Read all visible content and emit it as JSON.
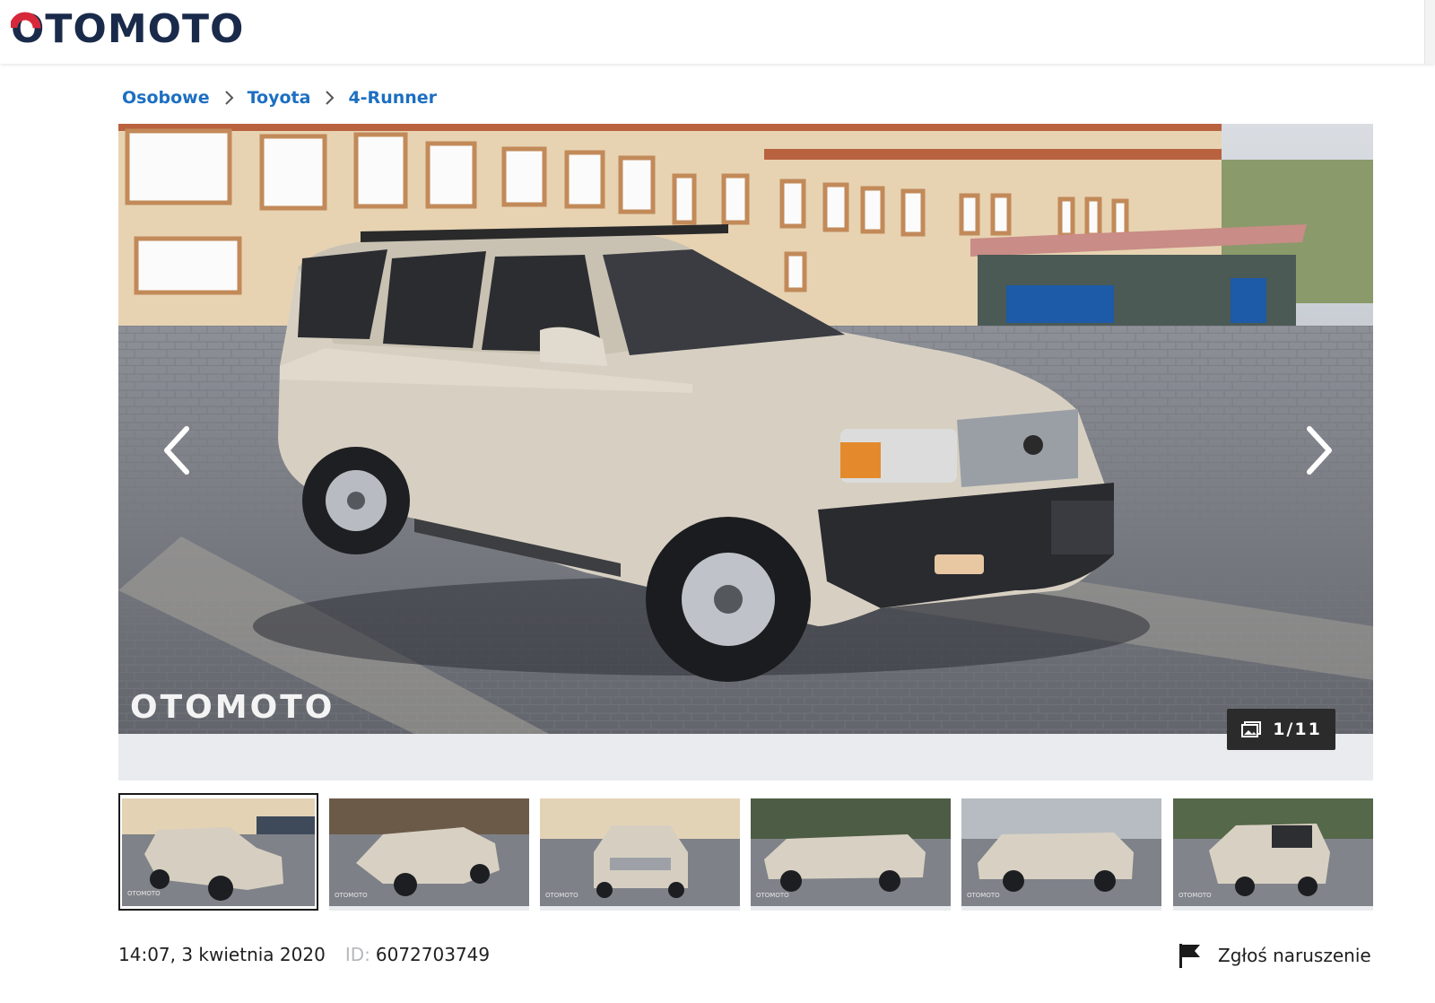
{
  "header": {
    "logo_text": "OTOMOTO"
  },
  "breadcrumb": {
    "items": [
      "Osobowe",
      "Toyota",
      "4-Runner"
    ]
  },
  "gallery": {
    "watermark": "OTOMOTO",
    "counter": "1/11",
    "prev_icon": "chevron-left-icon",
    "next_icon": "chevron-right-icon",
    "counter_icon": "photos-icon"
  },
  "thumbnails": {
    "count": 6,
    "selected_index": 0,
    "watermark": "OTOMOTO"
  },
  "meta": {
    "datetime": "14:07, 3 kwietnia 2020",
    "id_label": "ID:",
    "id_value": "6072703749"
  },
  "report": {
    "label": "Zgłoś naruszenie",
    "icon": "flag-icon"
  },
  "colors": {
    "logo_red": "#d6283a",
    "logo_blue": "#1a2a4a",
    "link_blue": "#1d6fc1",
    "strip_gray": "#e9ebef"
  }
}
